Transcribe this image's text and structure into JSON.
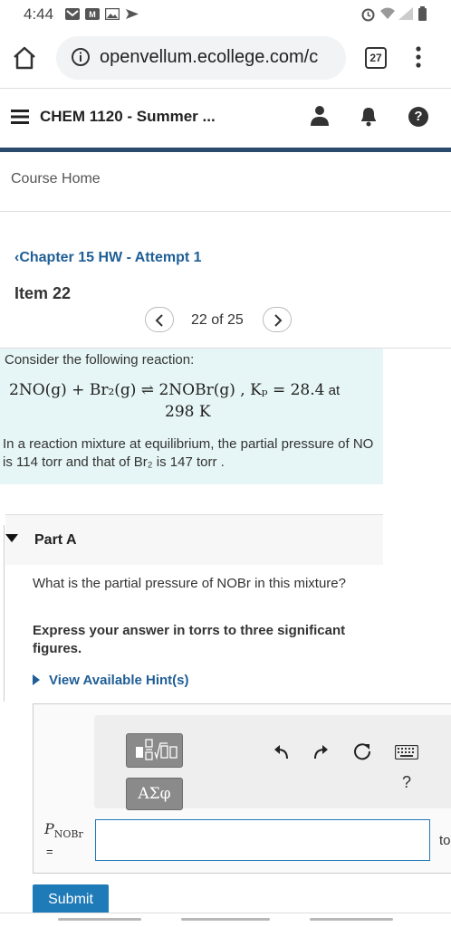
{
  "status_bar": {
    "time": "4:44"
  },
  "browser": {
    "url": "openvellum.ecollege.com/c",
    "tab_count": "27"
  },
  "header": {
    "course_title": "CHEM 1120 - Summer ..."
  },
  "nav": {
    "course_home": "Course Home",
    "chapter_link": "Chapter 15 HW - Attempt 1",
    "item_title": "Item 22",
    "pager_text": "22 of 25"
  },
  "intro": {
    "lead": "Consider the following reaction:",
    "reaction": "2NO(g) + Br₂(g) ⇌ 2NOBr(g) ,   Kₚ = 28.4",
    "reaction_at": " at",
    "temperature": "298 K",
    "description": "In a reaction mixture at equilibrium, the partial pressure of NO is 114 torr and that of Br₂ is 147 torr ."
  },
  "part_a": {
    "label": "Part A",
    "question": "What is the partial pressure of NOBr in this mixture?",
    "instructions": "Express your answer in torrs to three significant figures.",
    "hints_link": "View Available Hint(s)",
    "answer_label_main": "P",
    "answer_label_sub": "NOBr",
    "answer_eq": "=",
    "units": "to",
    "symbols_button": "ΑΣφ",
    "help_button": "?",
    "submit_button": "Submit"
  },
  "icons": {
    "status_left": [
      "gmail-icon",
      "mail-icon",
      "image-icon",
      "send-icon"
    ],
    "status_right": [
      "alarm-icon",
      "wifi-icon",
      "signal-icon",
      "battery-icon"
    ],
    "toolbar": [
      "undo-icon",
      "redo-icon",
      "reset-icon",
      "keyboard-icon"
    ]
  },
  "colors": {
    "link": "#1f5e96",
    "intro_background": "#e6f5f5",
    "header_accent": "#2a4a6e",
    "submit": "#1f7ab8"
  }
}
